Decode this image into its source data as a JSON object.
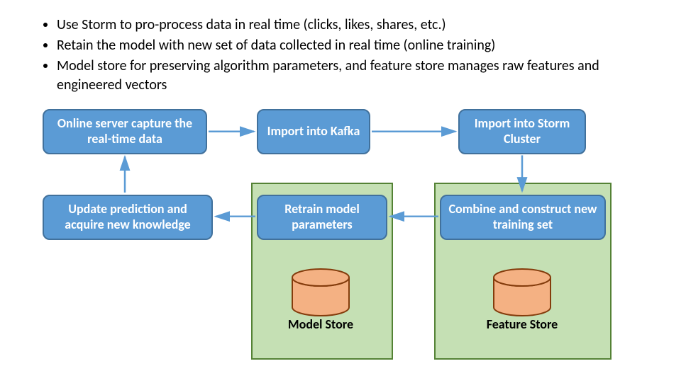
{
  "bullets": {
    "b1": "Use Storm to pro-process data in real time (clicks, likes, shares, etc.)",
    "b2": "Retain the model with new set of data collected in real time (online training)",
    "b3": "Model store for preserving algorithm parameters, and feature store manages raw features and engineered vectors"
  },
  "nodes": {
    "online_server": "Online server capture the real-time data",
    "import_kafka": "Import into Kafka",
    "import_storm": "Import into Storm Cluster",
    "update_pred": "Update prediction and acquire new knowledge",
    "retrain": "Retrain model parameters",
    "combine": "Combine and construct new training set"
  },
  "stores": {
    "model_store": "Model Store",
    "feature_store": "Feature Store"
  },
  "colors": {
    "node_fill": "#5b9bd5",
    "node_border": "#41719c",
    "green_fill": "#c5e0b4",
    "green_border": "#548235",
    "cyl_fill": "#f4b183",
    "cyl_border": "#843c0c",
    "arrow": "#5b9bd5"
  },
  "chart_data": {
    "type": "diagram",
    "title": "Real-time online training pipeline",
    "nodes": [
      {
        "id": "online_server",
        "label": "Online server capture the real-time data"
      },
      {
        "id": "import_kafka",
        "label": "Import into Kafka"
      },
      {
        "id": "import_storm",
        "label": "Import into Storm Cluster"
      },
      {
        "id": "combine",
        "label": "Combine and construct new training set",
        "container": "feature_store_box"
      },
      {
        "id": "retrain",
        "label": "Retrain model parameters",
        "container": "model_store_box"
      },
      {
        "id": "update_pred",
        "label": "Update prediction and acquire new knowledge"
      },
      {
        "id": "model_store",
        "label": "Model Store",
        "kind": "datastore",
        "container": "model_store_box"
      },
      {
        "id": "feature_store",
        "label": "Feature Store",
        "kind": "datastore",
        "container": "feature_store_box"
      }
    ],
    "edges": [
      {
        "from": "online_server",
        "to": "import_kafka"
      },
      {
        "from": "import_kafka",
        "to": "import_storm"
      },
      {
        "from": "import_storm",
        "to": "combine"
      },
      {
        "from": "combine",
        "to": "retrain"
      },
      {
        "from": "retrain",
        "to": "update_pred"
      },
      {
        "from": "update_pred",
        "to": "online_server"
      }
    ],
    "containers": [
      {
        "id": "model_store_box",
        "contains": [
          "retrain",
          "model_store"
        ]
      },
      {
        "id": "feature_store_box",
        "contains": [
          "combine",
          "feature_store"
        ]
      }
    ]
  }
}
